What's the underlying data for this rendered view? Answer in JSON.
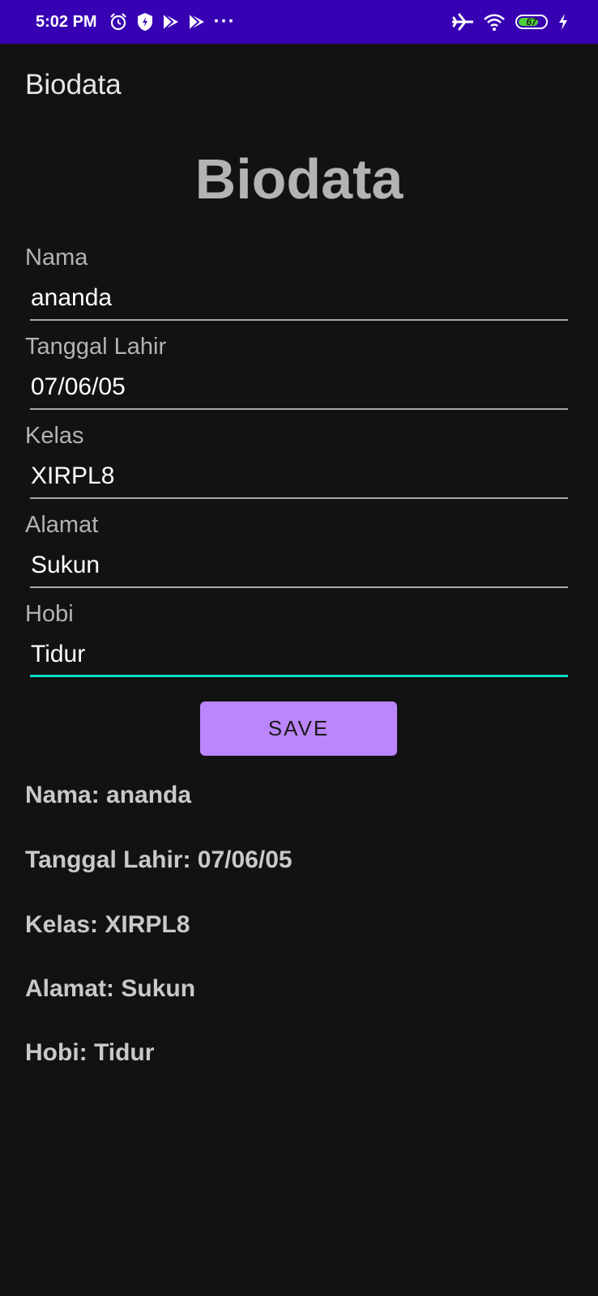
{
  "status_bar": {
    "time": "5:02 PM",
    "icons_left": [
      "alarm-icon",
      "shield-icon",
      "play-store-icon",
      "play-store-icon",
      "more-dots-icon"
    ],
    "more_dots": "···",
    "icons_right": [
      "airplane-mode-icon",
      "wifi-icon",
      "battery-icon",
      "charging-icon"
    ],
    "battery_level": "67",
    "background_color": "#3700b3"
  },
  "app_bar": {
    "title": "Biodata"
  },
  "form": {
    "heading": "Biodata",
    "fields": [
      {
        "label": "Nama",
        "value": "ananda"
      },
      {
        "label": "Tanggal Lahir",
        "value": "07/06/05"
      },
      {
        "label": "Kelas",
        "value": "XIRPL8"
      },
      {
        "label": "Alamat",
        "value": "Sukun"
      },
      {
        "label": "Hobi",
        "value": "Tidur"
      }
    ],
    "focused_field": "Hobi",
    "focus_color": "#03dac5",
    "save_label": "SAVE",
    "button_color": "#bb86fc"
  },
  "results": [
    "Nama: ananda",
    "Tanggal Lahir: 07/06/05",
    "Kelas: XIRPL8",
    "Alamat: Sukun",
    "Hobi: Tidur"
  ]
}
